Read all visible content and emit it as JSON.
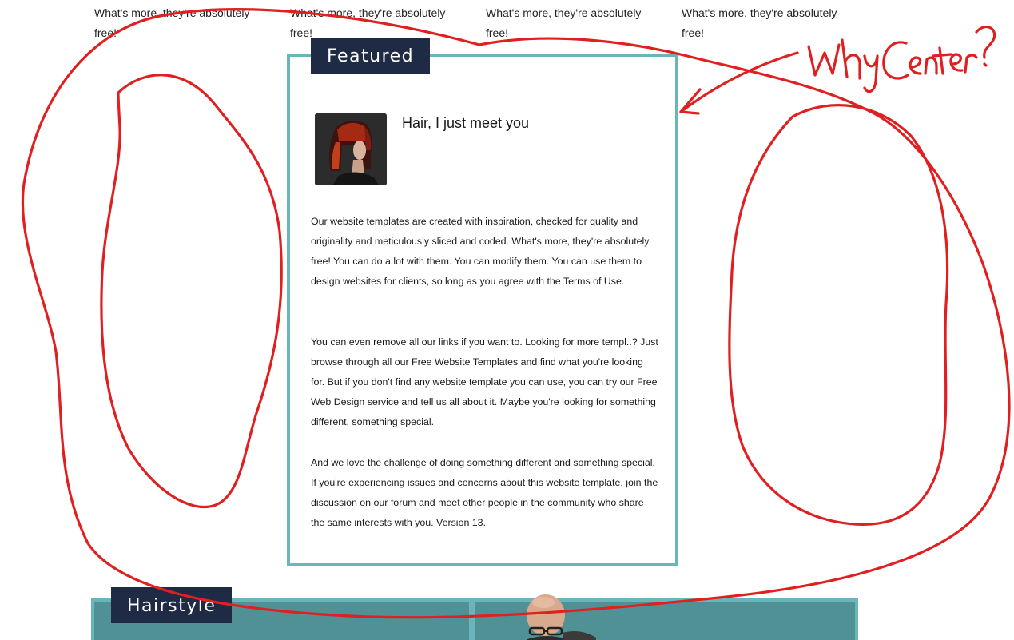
{
  "teasers": [
    {
      "text": "What's more, they're absolutely free!"
    },
    {
      "text": "What's more, they're absolutely free!"
    },
    {
      "text": "What's more, they're absolutely free!"
    },
    {
      "text": "What's more, they're absolutely free!"
    }
  ],
  "featured": {
    "tab_label": "Featured",
    "post_title": "Hair, I just meet you",
    "paragraphs": [
      "Our website templates are created with inspiration, checked for quality and originality and meticulously sliced and coded. What's more, they're absolutely free! You can do a lot with them. You can modify them. You can use them to design websites for clients, so long as you agree with the Terms of Use.",
      "You can even remove all our links if you want to. Looking for more templ..? Just browse through all our Free Website Templates and find what you're looking for. But if you don't find any website template you can use, you can try our Free Web Design service and tell us all about it. Maybe you're looking for something different, something special.",
      "And we love the challenge of doing something different and something special. If you're experiencing issues and concerns about this website template, join the discussion on our forum and meet other people in the community who share the same interests with you. Version 13."
    ]
  },
  "hairstyle": {
    "tab_label": "Hairstyle"
  },
  "annotation": {
    "handwritten_note": "Why Center?",
    "ink_color": "#e02020"
  },
  "colors": {
    "tab_bg": "#1f2a44",
    "box_border": "#6ab5bc",
    "band_bg": "#4f9194"
  }
}
